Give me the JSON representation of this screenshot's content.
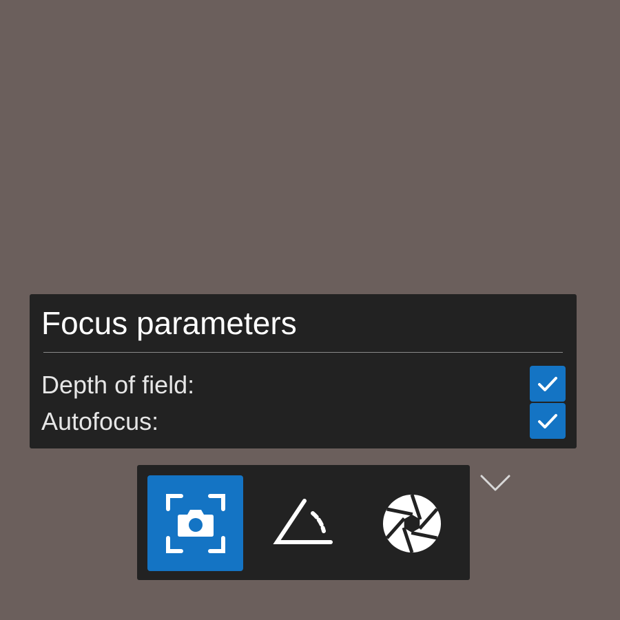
{
  "panel": {
    "title": "Focus parameters",
    "options": [
      {
        "label": "Depth of field:",
        "checked": true
      },
      {
        "label": "Autofocus:",
        "checked": true
      }
    ]
  },
  "toolbar": {
    "tools": [
      {
        "icon": "camera-focus-icon",
        "active": true
      },
      {
        "icon": "angle-icon",
        "active": false
      },
      {
        "icon": "aperture-icon",
        "active": false
      }
    ],
    "expand_icon": "chevron-down-icon"
  },
  "colors": {
    "background": "#6b5f5c",
    "panel": "#222222",
    "accent": "#1474c4",
    "text": "#ffffff"
  }
}
